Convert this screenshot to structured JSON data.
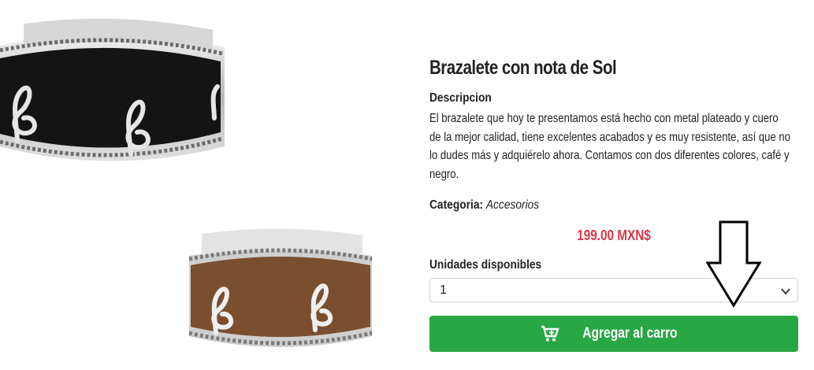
{
  "product": {
    "title": "Brazalete con nota de Sol",
    "description_heading": "Descripcion",
    "description": "El brazalete que hoy te presentamos está hecho con metal plateado y cuero de la mejor calidad, tiene excelentes acabados y es muy resistente, así que no lo dudes más y adquiérelo ahora. Contamos con dos diferentes colores, café y negro.",
    "category_label": "Categoria:",
    "category_value": "Accesorios",
    "price": "199.00 MXN$",
    "units_label": "Unidades disponibles",
    "units_selected": "1",
    "add_to_cart_label": "Agregar al carro"
  },
  "icons": {
    "cart": "cart-plus-icon",
    "select": "chevron-down-icon",
    "annotation": "down-arrow-icon"
  },
  "colors": {
    "price": "#dc3545",
    "button": "#28a745",
    "leather_black": "#121212",
    "leather_brown": "#7a4f2f",
    "silver": "#c9c9c9"
  }
}
